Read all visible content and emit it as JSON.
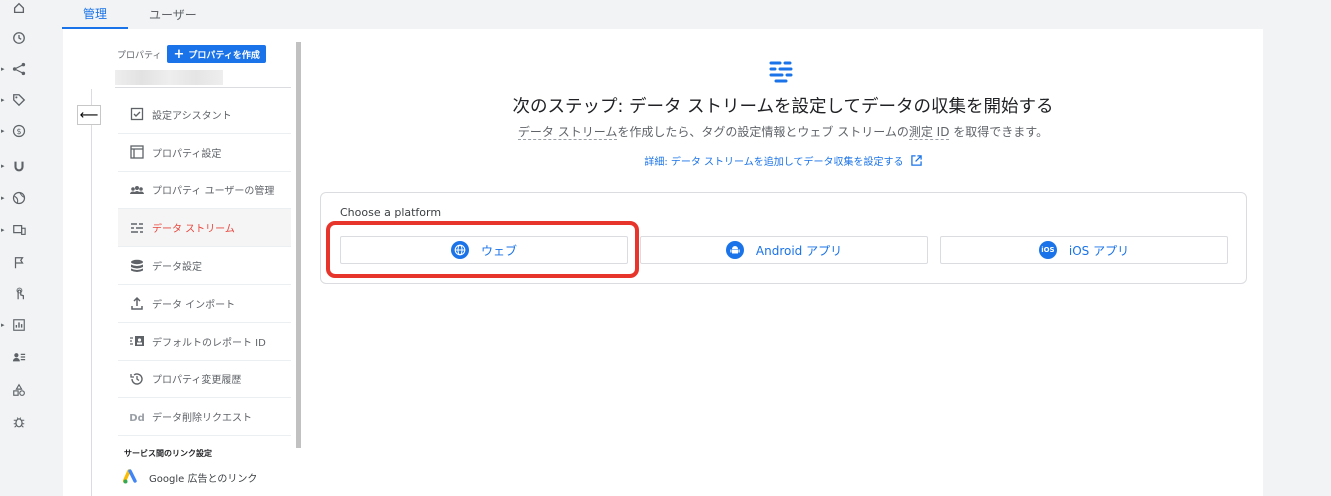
{
  "tabs": [
    {
      "label": "管理",
      "active": true
    },
    {
      "label": "ユーザー",
      "active": false
    }
  ],
  "rail": [
    {
      "icon": "home-icon"
    },
    {
      "icon": "clock-icon"
    },
    {
      "icon": "branch-icon"
    },
    {
      "icon": "tag-icon"
    },
    {
      "icon": "dollar-icon"
    },
    {
      "icon": "magnet-icon"
    },
    {
      "icon": "globe-icon"
    },
    {
      "icon": "devices-icon"
    },
    {
      "icon": "flag-icon"
    },
    {
      "icon": "touch-icon"
    },
    {
      "icon": "report-icon"
    },
    {
      "icon": "audience-icon"
    },
    {
      "icon": "shapes-icon"
    },
    {
      "icon": "debug-icon"
    }
  ],
  "property": {
    "label": "プロパティ",
    "create_button": "プロパティを作成"
  },
  "menu": [
    {
      "label": "設定アシスタント",
      "icon": "checklist-icon",
      "active": false
    },
    {
      "label": "プロパティ設定",
      "icon": "window-icon",
      "active": false
    },
    {
      "label": "プロパティ ユーザーの管理",
      "icon": "people-icon",
      "active": false
    },
    {
      "label": "データ ストリーム",
      "icon": "streams-icon",
      "active": true
    },
    {
      "label": "データ設定",
      "icon": "database-icon",
      "active": false
    },
    {
      "label": "データ インポート",
      "icon": "upload-icon",
      "active": false
    },
    {
      "label": "デフォルトのレポート ID",
      "icon": "report-id-icon",
      "active": false
    },
    {
      "label": "プロパティ変更履歴",
      "icon": "history-icon",
      "active": false
    },
    {
      "label": "データ削除リクエスト",
      "icon": "dd-icon",
      "active": false
    }
  ],
  "links_section": {
    "title": "サービス間のリンク設定",
    "item": "Google 広告とのリンク"
  },
  "main": {
    "title": "次のステップ: データ ストリームを設定してデータの収集を開始する",
    "subtitle": {
      "p1": "データ ストリーム",
      "p2": "を作成したら、タグの設定情報とウェブ ストリームの",
      "p3": "測定 ID",
      "p4": " を取得できます。"
    },
    "detail_link": "詳細: データ ストリームを追加してデータ収集を設定する",
    "platform_label": "Choose a platform",
    "platforms": [
      {
        "label": "ウェブ",
        "icon": "globe-icon"
      },
      {
        "label": "Android アプリ",
        "icon": "android-icon"
      },
      {
        "label": "iOS アプリ",
        "icon": "ios-icon",
        "icon_text": "iOS"
      }
    ]
  },
  "colors": {
    "accent": "#1a73e8",
    "active_menu": "#e8453c",
    "highlight": "#e8352b"
  }
}
